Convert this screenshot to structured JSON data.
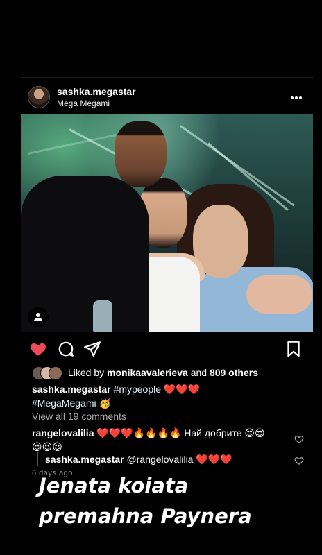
{
  "post": {
    "username": "sashka.megastar",
    "location": "Mega Megami",
    "more_icon": "more-horizontal-icon"
  },
  "photo": {
    "user_tag_icon": "person-icon"
  },
  "actions": {
    "like_icon": "heart-filled-icon",
    "like_color": "#ed4956",
    "comment_icon": "comment-icon",
    "share_icon": "send-icon",
    "save_icon": "bookmark-icon"
  },
  "likes": {
    "prefix": "Liked by",
    "user": "monikaavalerieva",
    "and": "and",
    "others": "809 others"
  },
  "caption": {
    "username": "sashka.megastar",
    "line1": "#mypeople ❤️❤️❤️",
    "line2": "#MegaMegami 🥳"
  },
  "view_comments": "View all 19 comments",
  "comments": [
    {
      "username": "rangelovalilia",
      "text": "❤️❤️❤️🔥🔥🔥🔥 Най добрите 😍😍",
      "text_cont": "😍😍😍"
    }
  ],
  "reply": {
    "username": "sashka.megastar",
    "text": "@rangelovalilia ❤️❤️❤️"
  },
  "time_ago": "6 days ago",
  "overlay": {
    "line1": "Jenata koiata",
    "line2": "premahna Paynera"
  }
}
